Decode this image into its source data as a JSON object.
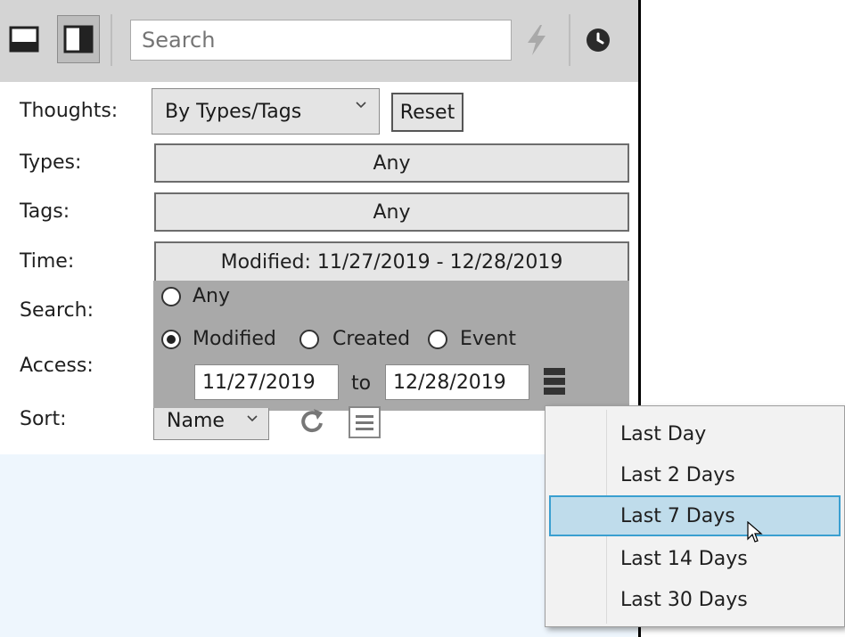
{
  "toolbar": {
    "search_placeholder": "Search"
  },
  "filters": {
    "thoughts": {
      "label": "Thoughts:",
      "value": "By Types/Tags",
      "reset_label": "Reset"
    },
    "types": {
      "label": "Types:",
      "value": "Any"
    },
    "tags": {
      "label": "Tags:",
      "value": "Any"
    },
    "time": {
      "label": "Time:",
      "value": "Modified: 11/27/2019 - 12/28/2019"
    },
    "search": {
      "label": "Search:"
    },
    "access": {
      "label": "Access:"
    },
    "sort": {
      "label": "Sort:",
      "value": "Name"
    }
  },
  "time_popup": {
    "option_any": "Any",
    "option_modified": "Modified",
    "option_created": "Created",
    "option_event": "Event",
    "selected": "Modified",
    "from_date": "11/27/2019",
    "to_label": "to",
    "to_date": "12/28/2019"
  },
  "range_menu": {
    "items": [
      "Last Day",
      "Last 2 Days",
      "Last 7 Days",
      "Last 14 Days",
      "Last 30 Days"
    ],
    "highlighted": "Last 7 Days"
  },
  "colors": {
    "toolbar_bg": "#d4d4d4",
    "popup_bg": "#a9a9a9",
    "highlight": "#bfdceb",
    "highlight_border": "#3a9fd0",
    "lower_bg": "#eef6fd"
  }
}
